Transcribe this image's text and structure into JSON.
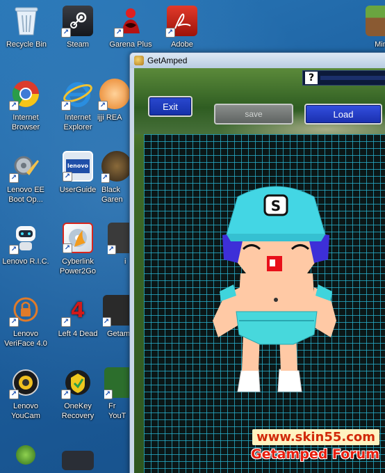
{
  "desktop_icons": [
    {
      "label": "Recycle Bin",
      "icon": "recycle-bin-icon"
    },
    {
      "label": "Steam",
      "icon": "steam-icon"
    },
    {
      "label": "Garena Plus",
      "icon": "garena-icon"
    },
    {
      "label": "Adobe",
      "icon": "adobe-icon"
    },
    {
      "label": "Internet\nBrowser",
      "icon": "chrome-icon"
    },
    {
      "label": "Internet\nExplorer",
      "icon": "internet-explorer-icon"
    },
    {
      "label": "ijji REA",
      "icon": "ijji-icon"
    },
    {
      "label": "Lenovo EE\nBoot Op...",
      "icon": "lenovo-boot-icon"
    },
    {
      "label": "UserGuide",
      "icon": "lenovo-userguide-icon"
    },
    {
      "label": "Black\nGaren",
      "icon": "black-garena-icon"
    },
    {
      "label": "Lenovo R.I.C.",
      "icon": "lenovo-ric-icon"
    },
    {
      "label": "Cyberlink\nPower2Go",
      "icon": "power2go-icon"
    },
    {
      "label": "i",
      "icon": "app-icon"
    },
    {
      "label": "Lenovo\nVeriFace 4.0",
      "icon": "veriface-icon"
    },
    {
      "label": "Left 4 Dead",
      "icon": "left4dead-icon"
    },
    {
      "label": "Getam",
      "icon": "getamped-icon"
    },
    {
      "label": "Lenovo\nYouCam",
      "icon": "youcam-icon"
    },
    {
      "label": "OneKey\nRecovery",
      "icon": "onekey-recovery-icon"
    },
    {
      "label": "Fr\nYouT",
      "icon": "youtube-downloader-icon"
    },
    {
      "label": "Min",
      "icon": "minecraft-icon"
    }
  ],
  "window": {
    "title": "GetAmped",
    "help_symbol": "?",
    "buttons": {
      "exit": "Exit",
      "save": "save",
      "load": "Load"
    },
    "character_badge": "S"
  },
  "watermark": {
    "site": "www.skin55.com",
    "forum": "Getamped Forum"
  }
}
